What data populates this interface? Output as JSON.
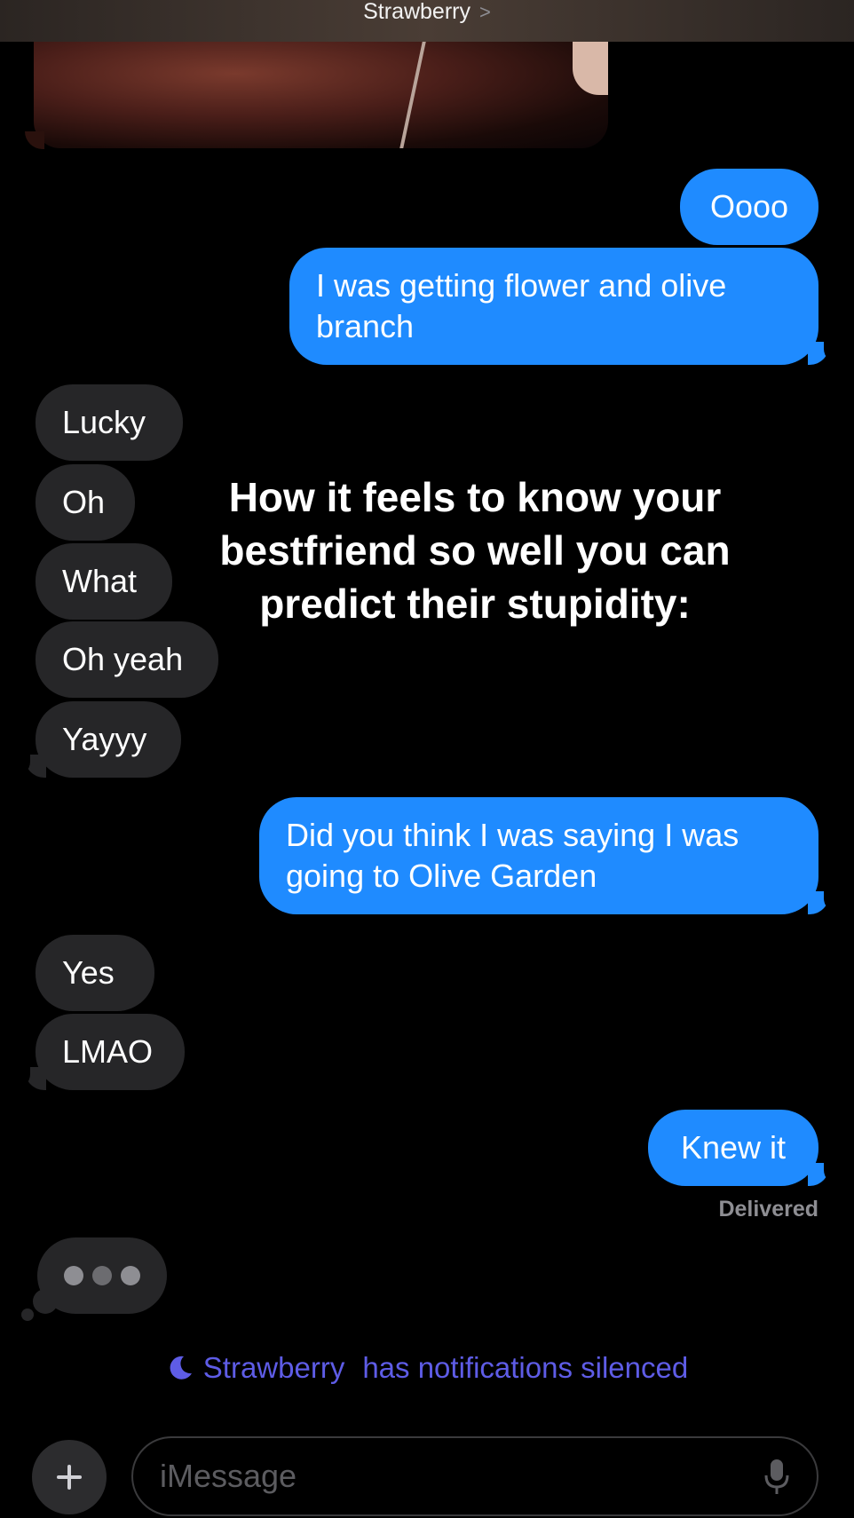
{
  "header": {
    "contact_name": "Strawberry",
    "chevron": ">"
  },
  "messages": [
    {
      "id": "m1",
      "direction": "outgoing",
      "text": "Oooo"
    },
    {
      "id": "m2",
      "direction": "outgoing",
      "text": "I was getting flower and olive branch"
    },
    {
      "id": "m3",
      "direction": "incoming",
      "text": "Lucky"
    },
    {
      "id": "m4",
      "direction": "incoming",
      "text": "Oh"
    },
    {
      "id": "m5",
      "direction": "incoming",
      "text": "What"
    },
    {
      "id": "m6",
      "direction": "incoming",
      "text": "Oh yeah"
    },
    {
      "id": "m7",
      "direction": "incoming",
      "text": "Yayyy"
    },
    {
      "id": "m8",
      "direction": "outgoing",
      "text": "Did you think I was saying I was going to Olive Garden"
    },
    {
      "id": "m9",
      "direction": "incoming",
      "text": "Yes"
    },
    {
      "id": "m10",
      "direction": "incoming",
      "text": "LMAO"
    },
    {
      "id": "m11",
      "direction": "outgoing",
      "text": "Knew it"
    }
  ],
  "status": {
    "delivered": "Delivered"
  },
  "overlay_caption": "How it feels to know your bestfriend so well you can predict their stupidity:",
  "notice": {
    "name": "Strawberry",
    "text": "has notifications silenced",
    "color": "#5e5ce6"
  },
  "composer": {
    "placeholder": "iMessage",
    "plus_icon": "plus-icon",
    "mic_icon": "mic-icon"
  },
  "colors": {
    "outgoing": "#1f8bff",
    "incoming": "#262628",
    "background": "#000000"
  }
}
